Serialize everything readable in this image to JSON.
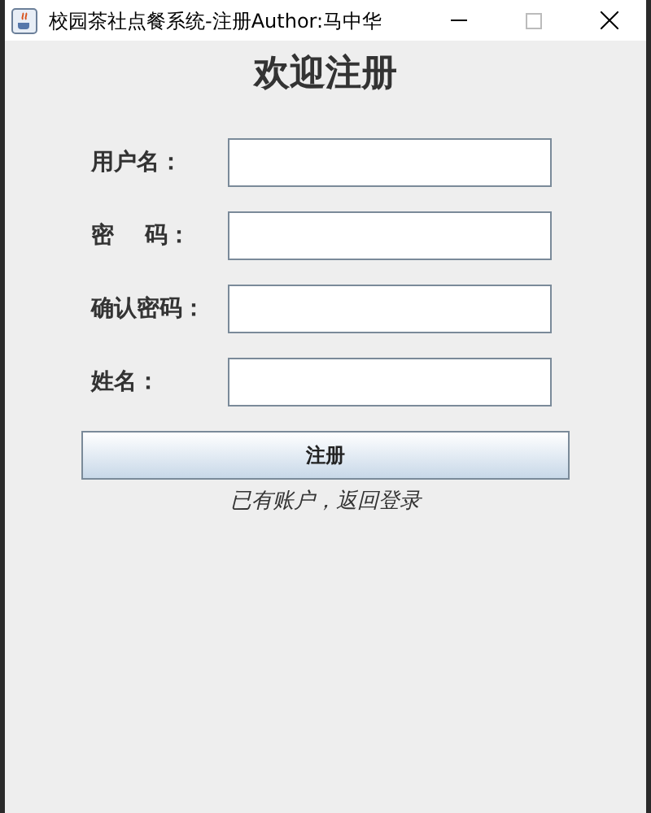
{
  "window": {
    "title": "校园茶社点餐系统-注册Author:马中华"
  },
  "heading": "欢迎注册",
  "fields": [
    {
      "label": "用户名："
    },
    {
      "label": "密　 码："
    },
    {
      "label": "确认密码："
    },
    {
      "label": "姓名："
    }
  ],
  "submit_button": "注册",
  "login_link": "已有账户，返回登录"
}
